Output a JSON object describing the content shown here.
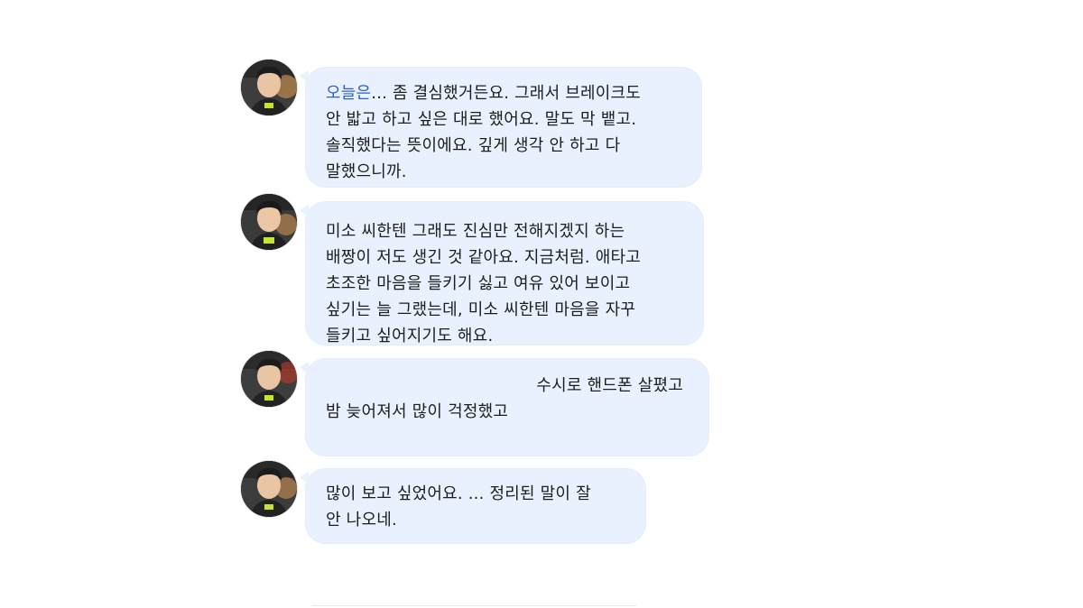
{
  "messages": [
    {
      "lines": [
        "오늘은",
        "... 좀 결심했거든요. 그래서 브레이크도",
        "안 밟고 하고 싶은 대로 했어요. 말도 막 뱉고.",
        "솔직했다는 뜻이에요. 깊게 생각 안 하고 다",
        "말했으니까."
      ]
    },
    {
      "lines": [
        "미소 씨한텐 그래도 진심만 전해지겠지 하는",
        "배짱이 저도 생긴 것 같아요. 지금처럼. 애타고",
        "초조한 마음을 들키기 싫고 여유 있어 보이고",
        "싶기는 늘 그랬는데, 미소 씨한텐 마음을 자꾸",
        "들키고 싶어지기도 해요."
      ]
    },
    {
      "lines": [
        "수시로 핸드폰 살폈고",
        "밤 늦어져서 많이 걱정했고"
      ]
    },
    {
      "lines": [
        "많이 보고 싶었어요. ... 정리된 말이 잘",
        "안 나오네."
      ]
    }
  ],
  "colors": {
    "bubble": "#e8f1fd",
    "highlight_text": "#2f62c9",
    "text": "#1e1e1e"
  },
  "icons": {
    "avatar": "profile-photo-avatar"
  }
}
